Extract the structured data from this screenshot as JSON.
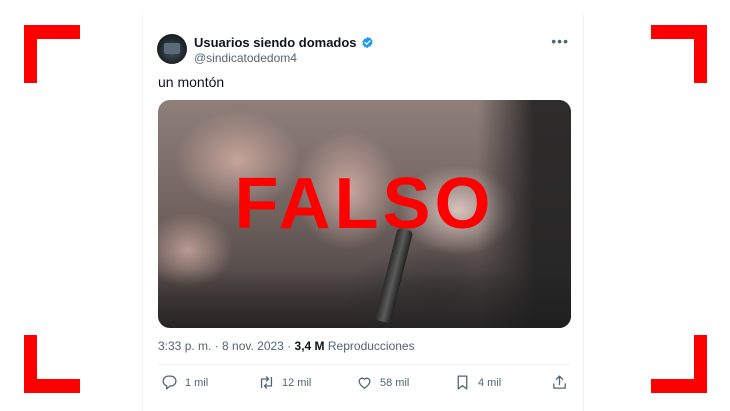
{
  "tweet": {
    "display_name": "Usuarios siendo domados",
    "handle": "@sindicatodedom4",
    "verified_icon": "verified-badge-icon",
    "more_label": "•••",
    "text": "un montón",
    "media": {
      "overlay_text": "FALSO",
      "overlay_color": "#ff0000"
    },
    "meta": {
      "time_date": "3:33 p. m. · 8 nov. 2023 · ",
      "views_count": "3,4 M",
      "views_label": " Reproducciones"
    },
    "actions": {
      "reply": {
        "icon": "reply-icon",
        "count": "1 mil"
      },
      "retweet": {
        "icon": "retweet-icon",
        "count": "12 mil"
      },
      "like": {
        "icon": "heart-icon",
        "count": "58 mil"
      },
      "bookmark": {
        "icon": "bookmark-icon",
        "count": "4 mil"
      },
      "share": {
        "icon": "share-icon"
      }
    }
  },
  "colors": {
    "corner_brackets": "#ff0000",
    "verified_blue": "#1d9bf0",
    "secondary_text": "#536471"
  }
}
